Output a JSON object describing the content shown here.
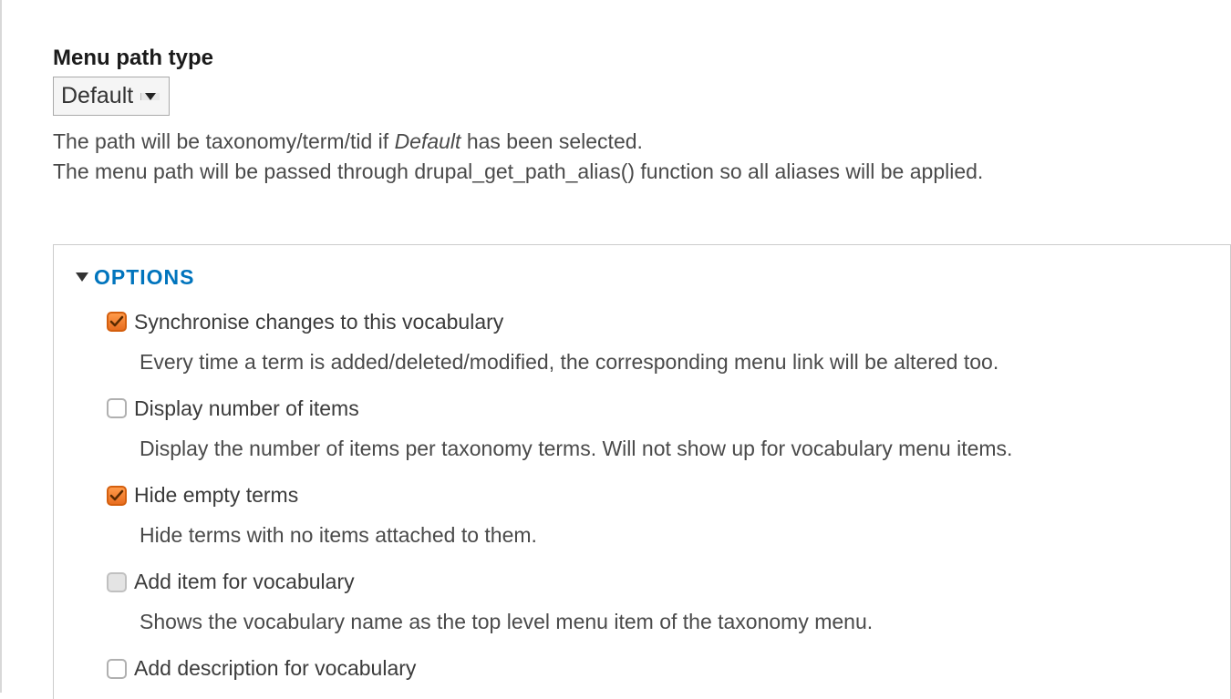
{
  "menuPath": {
    "label": "Menu path type",
    "selectValue": "Default",
    "description_line1_before": "The path will be taxonomy/term/tid if ",
    "description_line1_italic": "Default",
    "description_line1_after": " has been selected.",
    "description_line2": "The menu path will be passed through drupal_get_path_alias() function so all aliases will be applied."
  },
  "options": {
    "legend": "OPTIONS",
    "items": [
      {
        "label": "Synchronise changes to this vocabulary",
        "description": "Every time a term is added/deleted/modified, the corresponding menu link will be altered too.",
        "checked": true,
        "disabled": false
      },
      {
        "label": "Display number of items",
        "description": "Display the number of items per taxonomy terms. Will not show up for vocabulary menu items.",
        "checked": false,
        "disabled": false
      },
      {
        "label": "Hide empty terms",
        "description": "Hide terms with no items attached to them.",
        "checked": true,
        "disabled": false
      },
      {
        "label": "Add item for vocabulary",
        "description": "Shows the vocabulary name as the top level menu item of the taxonomy menu.",
        "checked": false,
        "disabled": true
      },
      {
        "label": "Add description for vocabulary",
        "description": "",
        "checked": false,
        "disabled": false
      }
    ]
  }
}
